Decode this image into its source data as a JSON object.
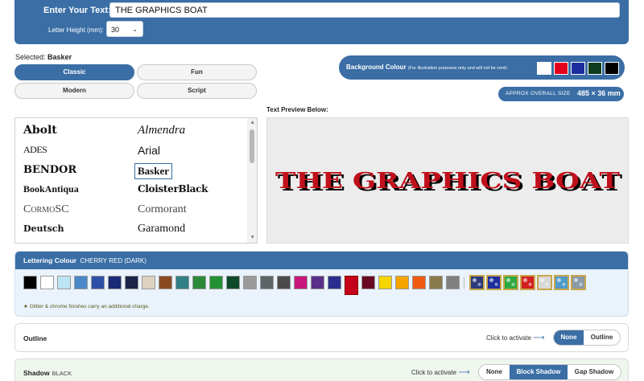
{
  "header": {
    "enter_label": "Enter Your Text:",
    "text_value": "THE GRAPHICS BOAT",
    "height_label": "Letter Height (mm):",
    "height_value": "30"
  },
  "selected": {
    "label": "Selected:",
    "value": "Basker"
  },
  "font_categories": [
    "Classic",
    "Fun",
    "Modern",
    "Script"
  ],
  "active_category": "Classic",
  "background": {
    "label": "Background Colour",
    "note": "(For illustration purposes only and will not be cent):",
    "swatches": [
      "#ffffff",
      "#e3001b",
      "#1d2d9e",
      "#0f3d1d",
      "#000000"
    ]
  },
  "size": {
    "label": "APPROX OVERALL SIZE",
    "value": "485 × 36 mm"
  },
  "preview": {
    "label": "Text Preview Below:",
    "text": "THE GRAPHICS BOAT",
    "fill": "#c0101c",
    "shadow": "#000000"
  },
  "fonts": [
    "Abolt",
    "Almendra",
    "ADES",
    "Arial",
    "BENDOR",
    "Basker",
    "BookAntiqua",
    "CloisterBlack",
    "CormoSC",
    "Cormorant",
    "Deutsch",
    "Garamond"
  ],
  "selected_font": "Basker",
  "lettering": {
    "label": "Lettering Colour",
    "selected_name": "CHERRY RED (DARK)",
    "colors": [
      "#000000",
      "#ffffff",
      "#bde4f4",
      "#4b88c8",
      "#2d4fa6",
      "#1a2a74",
      "#1b2548",
      "#ddd3bf",
      "#8a4b22",
      "#2f7f86",
      "#2a8a3a",
      "#239133",
      "#0e4a2a",
      "#9a9a9a",
      "#5f6466",
      "#4a4a4a",
      "#c8177a",
      "#5a2e8a",
      "#2a2f8f",
      "#c4001a",
      "#6a0a22",
      "#f6d400",
      "#f5a300",
      "#ee5a10",
      "#8a7a4a",
      "#808080"
    ],
    "selected_index": 19,
    "patterns": [
      "#2a3a7a",
      "#1d2d9e",
      "#2da840",
      "#d21f1f",
      "#d8d8d8",
      "#4f9ac8",
      "#8a9aa6"
    ],
    "note": "★ Glitter & chrome finishes carry an additional charge."
  },
  "outline": {
    "label": "Outline",
    "activate": "Click to activate",
    "options": [
      "None",
      "Outline"
    ],
    "active": "None"
  },
  "shadow": {
    "label": "Shadow",
    "value": "BLACK",
    "activate": "Click to activate",
    "options": [
      "None",
      "Block Shadow",
      "Gap Shadow"
    ],
    "active": "Block Shadow"
  }
}
